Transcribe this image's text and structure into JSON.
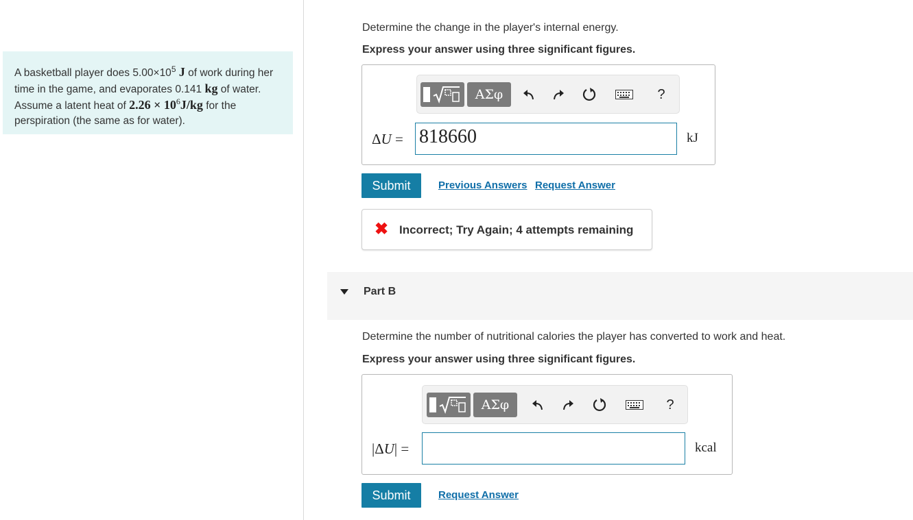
{
  "problem": {
    "text_1": "A basketball player does ",
    "work_value": "5.00×10",
    "work_exp": "5",
    "work_unit": "J",
    "text_2": " of work during her time in the game, and evaporates ",
    "mass_value": "0.141",
    "mass_unit": "kg",
    "text_3": " of water. Assume a latent heat of ",
    "latent_value": "2.26 × 10",
    "latent_exp": "6",
    "latent_unit": "J/kg",
    "text_4": " for the perspiration (the same as for water)."
  },
  "part_a": {
    "question": "Determine the change in the player's internal energy.",
    "instruction": "Express your answer using three significant figures.",
    "toolbar": {
      "math_button": "math-template",
      "greek_button": "ΑΣφ",
      "help_label": "?"
    },
    "variable_label": "ΔU =",
    "variable_symbol": "U",
    "input_value": "818660",
    "unit": "kJ",
    "submit_label": "Submit",
    "previous_answers_label": "Previous Answers",
    "request_answer_label": "Request Answer",
    "feedback": {
      "status": "incorrect",
      "message": "Incorrect; Try Again; 4 attempts remaining"
    }
  },
  "part_b": {
    "title": "Part B",
    "question": "Determine the number of nutritional calories the player has converted to work and heat.",
    "instruction": "Express your answer using three significant figures.",
    "toolbar": {
      "greek_button": "ΑΣφ",
      "help_label": "?"
    },
    "variable_label": "|ΔU| =",
    "input_value": "",
    "unit": "kcal",
    "submit_label": "Submit",
    "request_answer_label": "Request Answer"
  },
  "colors": {
    "problem_bg": "#e4f5f5",
    "submit_bg": "#157ea5",
    "link": "#0f6ea8",
    "input_border": "#1a7fa5",
    "error_icon": "#e11111"
  }
}
